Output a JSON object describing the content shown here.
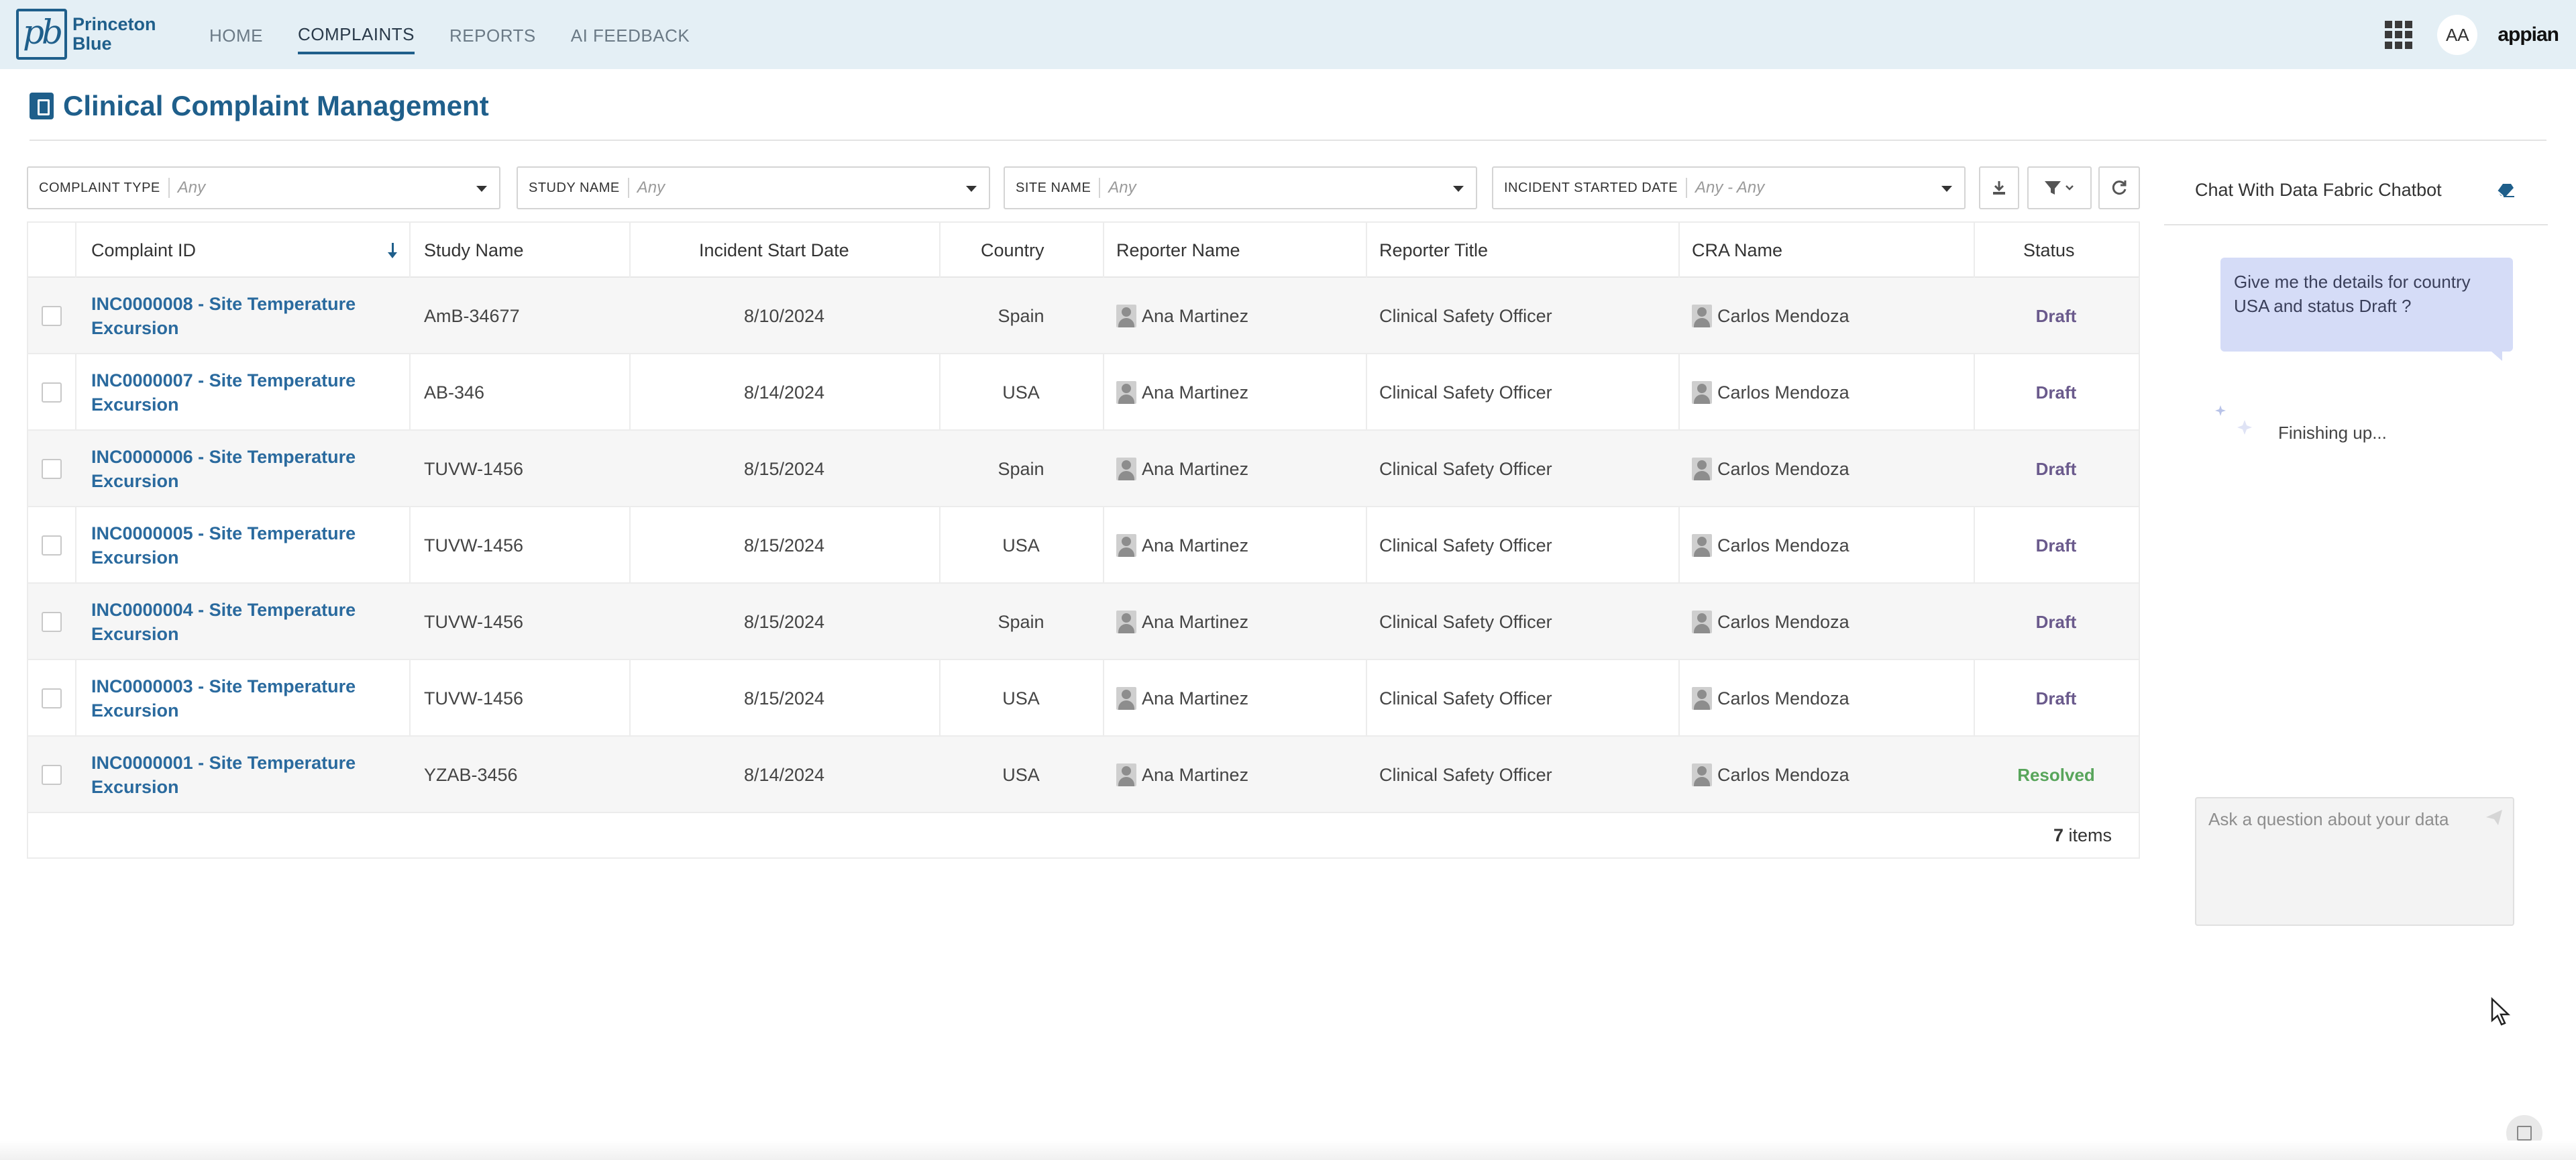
{
  "header": {
    "logo_line1": "Princeton",
    "logo_line2": "Blue",
    "logo_mark": "pb",
    "nav": [
      {
        "label": "HOME",
        "active": false
      },
      {
        "label": "COMPLAINTS",
        "active": true
      },
      {
        "label": "REPORTS",
        "active": false
      },
      {
        "label": "AI FEEDBACK",
        "active": false
      }
    ],
    "avatar_initials": "AA",
    "brand": "appian"
  },
  "page": {
    "title": "Clinical Complaint Management"
  },
  "filters": [
    {
      "label": "COMPLAINT TYPE",
      "value": "Any"
    },
    {
      "label": "STUDY NAME",
      "value": "Any"
    },
    {
      "label": "SITE NAME",
      "value": "Any"
    },
    {
      "label": "INCIDENT STARTED DATE",
      "value": "Any - Any"
    }
  ],
  "table": {
    "columns": [
      "Complaint ID",
      "Study Name",
      "Incident Start Date",
      "Country",
      "Reporter Name",
      "Reporter Title",
      "CRA Name",
      "Status"
    ],
    "rows": [
      {
        "id_line1": "INC0000008 - Site Temperature",
        "id_line2": "Excursion",
        "study": "AmB-34677",
        "date": "8/10/2024",
        "country": "Spain",
        "reporter": "Ana Martinez",
        "title": "Clinical Safety Officer",
        "cra": "Carlos Mendoza",
        "status": "Draft"
      },
      {
        "id_line1": "INC0000007 - Site Temperature",
        "id_line2": "Excursion",
        "study": "AB-346",
        "date": "8/14/2024",
        "country": "USA",
        "reporter": "Ana Martinez",
        "title": "Clinical Safety Officer",
        "cra": "Carlos Mendoza",
        "status": "Draft"
      },
      {
        "id_line1": "INC0000006 - Site Temperature",
        "id_line2": "Excursion",
        "study": "TUVW-1456",
        "date": "8/15/2024",
        "country": "Spain",
        "reporter": "Ana Martinez",
        "title": "Clinical Safety Officer",
        "cra": "Carlos Mendoza",
        "status": "Draft"
      },
      {
        "id_line1": "INC0000005 - Site Temperature",
        "id_line2": "Excursion",
        "study": "TUVW-1456",
        "date": "8/15/2024",
        "country": "USA",
        "reporter": "Ana Martinez",
        "title": "Clinical Safety Officer",
        "cra": "Carlos Mendoza",
        "status": "Draft"
      },
      {
        "id_line1": "INC0000004 - Site Temperature",
        "id_line2": "Excursion",
        "study": "TUVW-1456",
        "date": "8/15/2024",
        "country": "Spain",
        "reporter": "Ana Martinez",
        "title": "Clinical Safety Officer",
        "cra": "Carlos Mendoza",
        "status": "Draft"
      },
      {
        "id_line1": "INC0000003 - Site Temperature",
        "id_line2": "Excursion",
        "study": "TUVW-1456",
        "date": "8/15/2024",
        "country": "USA",
        "reporter": "Ana Martinez",
        "title": "Clinical Safety Officer",
        "cra": "Carlos Mendoza",
        "status": "Draft"
      },
      {
        "id_line1": "INC0000001 - Site Temperature",
        "id_line2": "Excursion",
        "study": "YZAB-3456",
        "date": "8/14/2024",
        "country": "USA",
        "reporter": "Ana Martinez",
        "title": "Clinical Safety Officer",
        "cra": "Carlos Mendoza",
        "status": "Resolved"
      }
    ],
    "count_number": "7",
    "count_label": "items"
  },
  "chat": {
    "title": "Chat With Data Fabric Chatbot",
    "user_message": "Give me the details for country USA and status Draft ?",
    "status_text": "Finishing up...",
    "input_placeholder": "Ask a question about your data"
  },
  "colors": {
    "header_bg": "#e4eff5",
    "brand_blue": "#1f5f8b",
    "link": "#2a6a9e",
    "draft": "#6a5a8c",
    "resolved": "#58a55b",
    "bubble": "#d5dcf7"
  }
}
